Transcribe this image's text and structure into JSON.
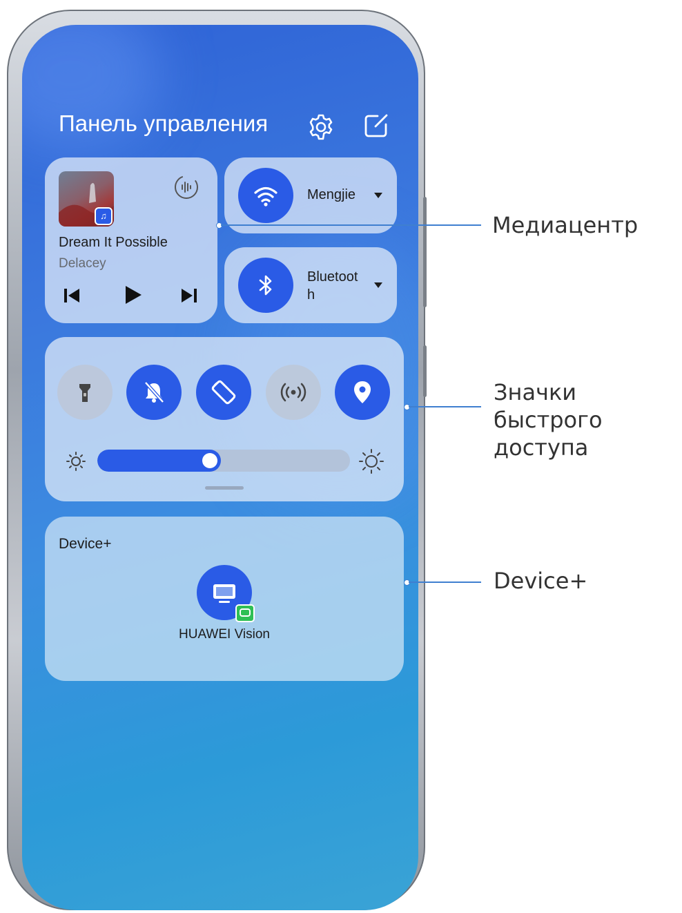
{
  "panel": {
    "title": "Панель управления",
    "settings_icon": "gear-icon",
    "edit_icon": "edit-icon"
  },
  "media": {
    "song": "Dream It Possible",
    "artist": "Delacey",
    "controls": [
      "previous-icon",
      "play-icon",
      "next-icon"
    ],
    "audio_icon": "audio-output-icon"
  },
  "wifi": {
    "name": "Mengjie",
    "icon": "wifi-icon",
    "active": true
  },
  "bluetooth": {
    "name_line1": "Bluetoot",
    "name_line2": "h",
    "icon": "bluetooth-icon",
    "active": true
  },
  "shortcuts": [
    {
      "name": "flashlight-icon",
      "active": false
    },
    {
      "name": "mute-bell-icon",
      "active": true
    },
    {
      "name": "auto-rotate-icon",
      "active": true
    },
    {
      "name": "hotspot-icon",
      "active": false
    },
    {
      "name": "location-icon",
      "active": true
    }
  ],
  "brightness": {
    "level": 0.49
  },
  "device_plus": {
    "title": "Device+",
    "device": "HUAWEI Vision"
  },
  "callouts": {
    "media": "Медиацентр",
    "shortcuts_line1": "Значки быстрого",
    "shortcuts_line2": "доступа",
    "device": "Device+"
  },
  "colors": {
    "accent": "#2a5be6",
    "callout": "#3f7fd0"
  }
}
